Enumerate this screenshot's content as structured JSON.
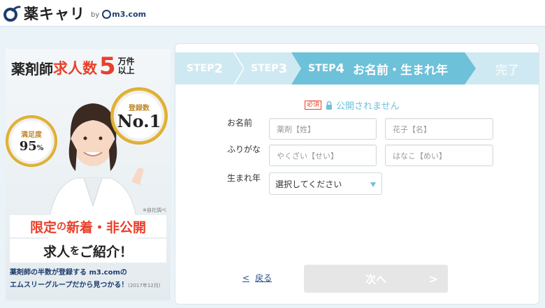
{
  "header": {
    "logo_text": "薬キャリ",
    "by": "by",
    "m3": "m3.com"
  },
  "banner": {
    "headline_a": "薬剤師",
    "headline_b": "求人数",
    "headline_num": "5",
    "headline_unit_1": "万件",
    "headline_unit_2": "以上",
    "medal_registered_label": "登録数",
    "medal_registered_value": "No.1",
    "medal_satisfaction_label": "満足度",
    "medal_satisfaction_value": "95",
    "medal_satisfaction_unit": "%",
    "note": "※自社調べ",
    "red_1": "限定",
    "red_of": "の",
    "red_2": "新着・非公開",
    "intro_a": "求人",
    "intro_b": "を",
    "intro_c": "ご紹介！",
    "footer_1": "薬剤師の半数",
    "footer_2": "が登録する",
    "footer_m3": "m3.com",
    "footer_3": "の",
    "footer_4": "エムスリーグループだから見つかる！",
    "footer_date": "(2017年12月)"
  },
  "steps": {
    "step2": "STEP",
    "step2_num": "2",
    "step3": "STEP",
    "step3_num": "3",
    "step4": "STEP",
    "step4_num": "4",
    "step4_title": "お名前・生まれ年",
    "done": "完了"
  },
  "form": {
    "required_badge": "必須",
    "private_text": "公開されません",
    "name_label": "お名前",
    "last_name_placeholder": "薬剤【姓】",
    "first_name_placeholder": "花子【名】",
    "kana_label": "ふりがな",
    "last_kana_placeholder": "やくざい【せい】",
    "first_kana_placeholder": "はなこ【めい】",
    "birth_label": "生まれ年",
    "birth_selected": "選択してください"
  },
  "nav": {
    "back_arrow": "<",
    "back_label": "戻る",
    "next_label": "次へ",
    "next_arrow": ">"
  },
  "colors": {
    "accent": "#6dc1d9",
    "red": "#e8402a",
    "navy": "#1d3d6e"
  }
}
